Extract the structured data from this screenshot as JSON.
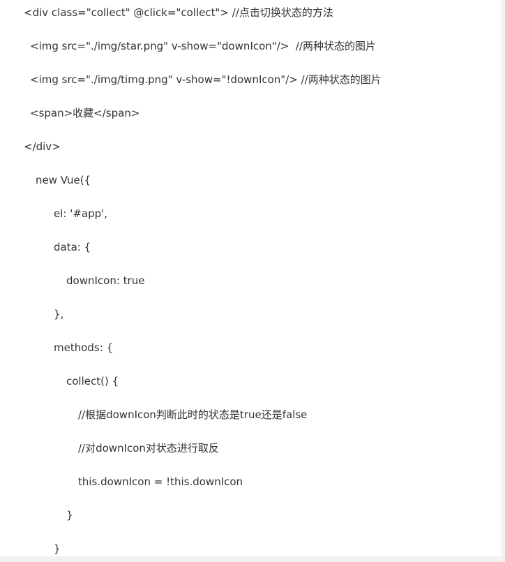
{
  "code_lines": [
    "<div class=\"collect\" @click=\"collect\"> //点击切换状态的方法",
    "<img src=\"./img/star.png\" v-show=\"downIcon\"/>  //两种状态的图片",
    "<img src=\"./img/timg.png\" v-show=\"!downIcon\"/> //两种状态的图片",
    "<span>收藏</span>",
    "</div>",
    "new Vue({",
    "el: '#app',",
    "data: {",
    "downIcon: true",
    "},",
    "methods: {",
    "collect() {",
    "//根据downIcon判断此时的状态是true还是false",
    "//对downIcon对状态进行取反",
    "this.downIcon = !this.downIcon",
    "}",
    "}"
  ]
}
